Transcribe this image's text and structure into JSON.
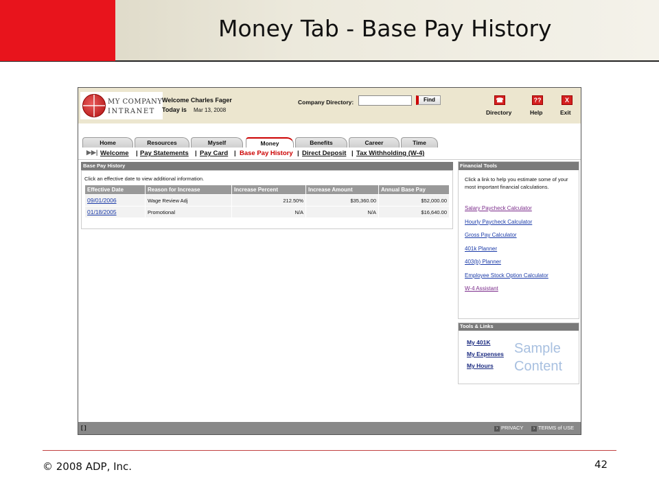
{
  "slide": {
    "title": "Money Tab - Base Pay History",
    "copyright": "© 2008 ADP, Inc.",
    "page_number": "42"
  },
  "header": {
    "logo_line1": "MY COMPANY",
    "logo_line2": "INTRANET",
    "welcome": "Welcome Charles Fager",
    "today_label": "Today is",
    "today_date": "Mar 13, 2008",
    "company_directory_label": "Company Directory:",
    "company_directory_value": "",
    "find_label": "Find",
    "toolbar": [
      {
        "label": "Directory",
        "icon": "phone-icon",
        "glyph": "☎"
      },
      {
        "label": "Help",
        "icon": "help-icon",
        "glyph": "??"
      },
      {
        "label": "Exit",
        "icon": "exit-icon",
        "glyph": "X"
      }
    ]
  },
  "tabs": [
    "Home",
    "Resources",
    "Myself",
    "Money",
    "Benefits",
    "Career",
    "Time"
  ],
  "active_tab": "Money",
  "subnav": [
    "Welcome",
    "Pay Statements",
    "Pay Card",
    "Base Pay History",
    "Direct Deposit",
    "Tax Withholding (W-4)"
  ],
  "active_subnav": "Base Pay History",
  "base_pay": {
    "heading": "Base Pay History",
    "hint": "Click an effective date to view additional information.",
    "columns": [
      "Effective Date",
      "Reason for Increase",
      "Increase Percent",
      "Increase Amount",
      "Annual Base Pay"
    ],
    "rows": [
      [
        "09/01/2006",
        "Wage Review Adj",
        "212.50%",
        "$35,360.00",
        "$52,000.00"
      ],
      [
        "01/18/2005",
        "Promotional",
        "N/A",
        "N/A",
        "$16,640.00"
      ]
    ]
  },
  "financial_tools": {
    "heading": "Financial Tools",
    "intro": "Click a link to help you estimate some of your most important financial calculations.",
    "links": [
      "Salary Paycheck Calculator",
      "Hourly Paycheck Calculator",
      "Gross Pay Calculator",
      "401k Planner",
      "403(b) Planner",
      "Employee Stock Option Calculator",
      "W-4 Assistant"
    ]
  },
  "tools_links": {
    "heading": "Tools & Links",
    "links": [
      "My 401K",
      "My Expenses",
      "My Hours"
    ],
    "watermark_line1": "Sample",
    "watermark_line2": "Content"
  },
  "footer_bar": {
    "left": "[ ]",
    "privacy": "PRIVACY",
    "terms": "TERMS of USE"
  },
  "colors": {
    "accent_red": "#e8141c",
    "link_blue": "#1a3aa8",
    "panel_gray": "#7a7a7a"
  }
}
